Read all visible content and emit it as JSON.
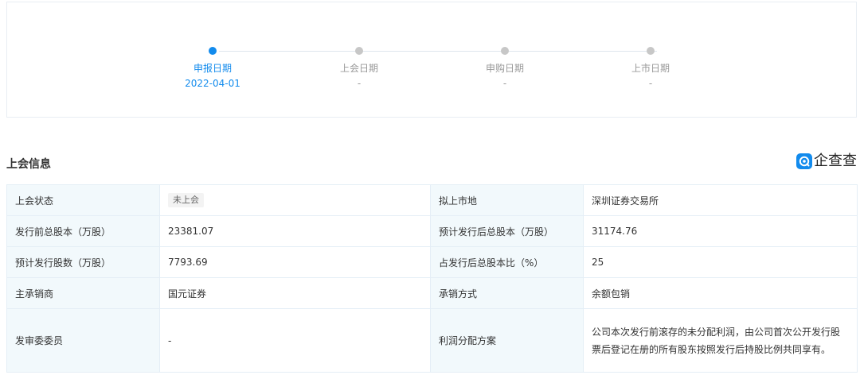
{
  "timeline": {
    "steps": [
      {
        "label": "申报日期",
        "value": "2022-04-01",
        "active": true
      },
      {
        "label": "上会日期",
        "value": "-",
        "active": false
      },
      {
        "label": "申购日期",
        "value": "-",
        "active": false
      },
      {
        "label": "上市日期",
        "value": "-",
        "active": false
      }
    ]
  },
  "section": {
    "title": "上会信息",
    "brand": "企查查"
  },
  "table": {
    "rows": [
      {
        "k1": "上会状态",
        "v1": "未上会",
        "k2": "拟上市地",
        "v2": "深圳证券交易所"
      },
      {
        "k1": "发行前总股本（万股）",
        "v1": "23381.07",
        "k2": "预计发行后总股本（万股）",
        "v2": "31174.76"
      },
      {
        "k1": "预计发行股数（万股）",
        "v1": "7793.69",
        "k2": "占发行后总股本比（%）",
        "v2": "25"
      },
      {
        "k1": "主承销商",
        "v1": "国元证券",
        "k2": "承销方式",
        "v2": "余额包销"
      },
      {
        "k1": "发审委委员",
        "v1": "-",
        "k2": "利润分配方案",
        "v2": "公司本次发行前滚存的未分配利润，由公司首次公开发行股票后登记在册的所有股东按照发行后持股比例共同享有。"
      }
    ]
  },
  "colors": {
    "accent": "#128bed",
    "inactive": "#c7c7c7",
    "key_bg": "#f2f9fc"
  },
  "icons": {
    "brand": "qichacha-logo-icon"
  }
}
